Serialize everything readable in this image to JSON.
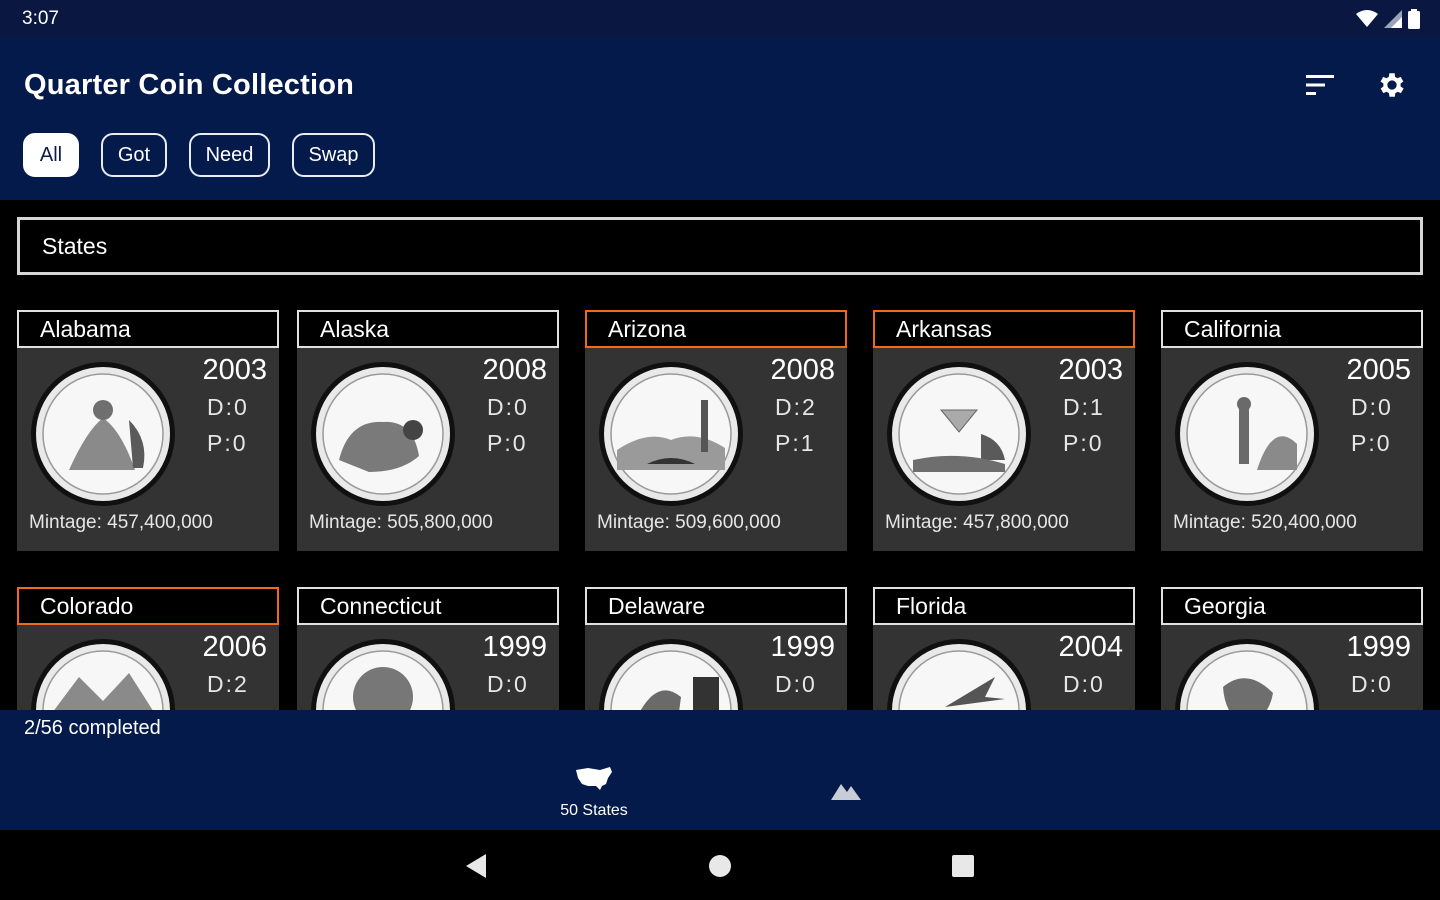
{
  "status": {
    "time": "3:07"
  },
  "app": {
    "title": "Quarter Coin Collection"
  },
  "filters": [
    {
      "label": "All",
      "selected": true
    },
    {
      "label": "Got",
      "selected": false
    },
    {
      "label": "Need",
      "selected": false
    },
    {
      "label": "Swap",
      "selected": false
    }
  ],
  "section": {
    "title": "States"
  },
  "cards": [
    {
      "name": "Alabama",
      "year": "2003",
      "d": "D:0",
      "p": "P:0",
      "mintage": "Mintage: 457,400,000",
      "highlight": false
    },
    {
      "name": "Alaska",
      "year": "2008",
      "d": "D:0",
      "p": "P:0",
      "mintage": "Mintage: 505,800,000",
      "highlight": false
    },
    {
      "name": "Arizona",
      "year": "2008",
      "d": "D:2",
      "p": "P:1",
      "mintage": "Mintage: 509,600,000",
      "highlight": true
    },
    {
      "name": "Arkansas",
      "year": "2003",
      "d": "D:1",
      "p": "P:0",
      "mintage": "Mintage: 457,800,000",
      "highlight": true
    },
    {
      "name": "California",
      "year": "2005",
      "d": "D:0",
      "p": "P:0",
      "mintage": "Mintage: 520,400,000",
      "highlight": false
    },
    {
      "name": "Colorado",
      "year": "2006",
      "d": "D:2",
      "p": "",
      "mintage": "",
      "highlight": true
    },
    {
      "name": "Connecticut",
      "year": "1999",
      "d": "D:0",
      "p": "",
      "mintage": "",
      "highlight": false
    },
    {
      "name": "Delaware",
      "year": "1999",
      "d": "D:0",
      "p": "",
      "mintage": "",
      "highlight": false
    },
    {
      "name": "Florida",
      "year": "2004",
      "d": "D:0",
      "p": "",
      "mintage": "",
      "highlight": false
    },
    {
      "name": "Georgia",
      "year": "1999",
      "d": "D:0",
      "p": "",
      "mintage": "",
      "highlight": false
    }
  ],
  "progress": {
    "text": "2/56 completed"
  },
  "bottom_nav": [
    {
      "label": "50 States",
      "icon": "usa-map-icon",
      "selected": true
    },
    {
      "label": "",
      "icon": "mountains-icon",
      "selected": false
    }
  ],
  "colors": {
    "app_bar": "#041a4a",
    "card": "#333333",
    "highlight": "#f06a1d"
  }
}
